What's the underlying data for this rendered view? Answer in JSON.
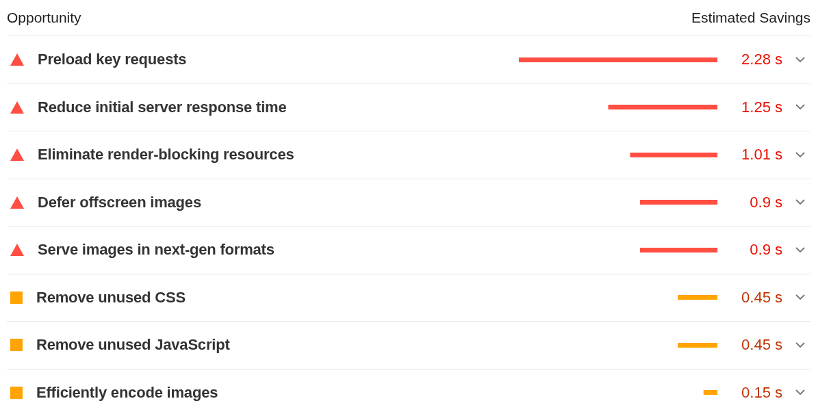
{
  "header": {
    "opportunity": "Opportunity",
    "savings": "Estimated Savings"
  },
  "rows": [
    {
      "title": "Preload key requests",
      "kind": "fail",
      "level": 1.0,
      "savings": "2.28 s",
      "expanded": false
    },
    {
      "title": "Reduce initial server response time",
      "kind": "fail",
      "level": 0.55,
      "savings": "1.25 s",
      "expanded": false
    },
    {
      "title": "Eliminate render-blocking resources",
      "kind": "fail",
      "level": 0.44,
      "savings": "1.01 s",
      "expanded": false
    },
    {
      "title": "Defer offscreen images",
      "kind": "fail",
      "level": 0.39,
      "savings": "0.9 s",
      "expanded": false
    },
    {
      "title": "Serve images in next-gen formats",
      "kind": "fail",
      "level": 0.39,
      "savings": "0.9 s",
      "expanded": false
    },
    {
      "title": "Remove unused CSS",
      "kind": "average",
      "level": 0.2,
      "savings": "0.45 s",
      "expanded": false
    },
    {
      "title": "Remove unused JavaScript",
      "kind": "average",
      "level": 0.2,
      "savings": "0.45 s",
      "expanded": false
    },
    {
      "title": "Efficiently encode images",
      "kind": "average",
      "level": 0.07,
      "savings": "0.15 s",
      "expanded": false
    }
  ]
}
